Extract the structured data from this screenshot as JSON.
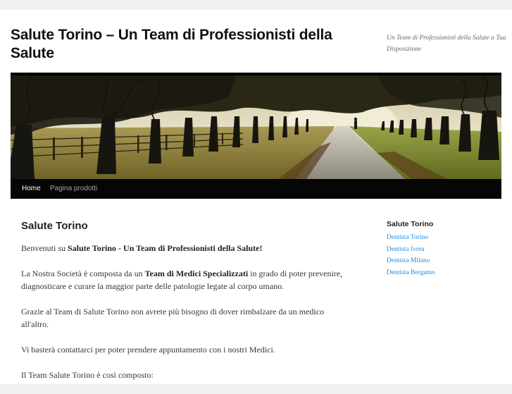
{
  "header": {
    "site_title": "Salute Torino – Un Team di Professionisti della Salute",
    "site_description": "Un Team di Professionisti della Salute a Tua Disposizione"
  },
  "nav": {
    "items": [
      {
        "label": "Home",
        "active": true
      },
      {
        "label": "Pagina prodotti",
        "active": false
      }
    ]
  },
  "content": {
    "title": "Salute Torino",
    "p1": {
      "pre": "Benvenuti su ",
      "b1": "Salute Torino",
      "mid": " - ",
      "b2": "Un Team di Professionisti della Salute!"
    },
    "p2": {
      "pre": "La Nostra Società è composta da un ",
      "b1": "Team di Medici Specializzati",
      "post": " in grado di poter prevenire, diagnosticare e curare la maggior parte delle patologie legate al corpo umano."
    },
    "p3": "Grazie al Team di Salute Torino non avrete più bisogno di dover rimbalzare da un medico all'altro.",
    "p4": "Vi basterà contattarci per poter prendere appuntamento con i nostri Medici.",
    "p5": "Il Team Salute Torino è così composto:"
  },
  "sidebar": {
    "widget_title": "Salute Torino",
    "links": [
      "Dentista Torino",
      "Dentista Ivrea",
      "Dentista Milano",
      "Dentista Bergamo"
    ]
  },
  "colors": {
    "link": "#1b8be0",
    "nav_bg": "#060606",
    "page_bg": "#f1f1f1"
  }
}
